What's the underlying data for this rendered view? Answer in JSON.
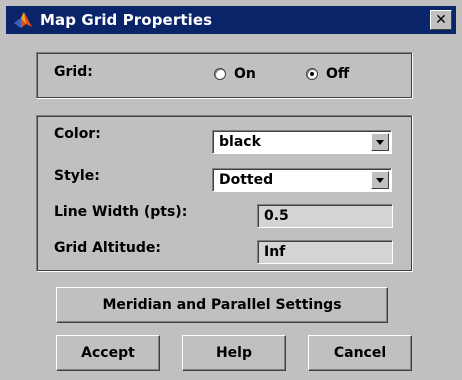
{
  "window": {
    "title": "Map Grid Properties",
    "close_label": "✕"
  },
  "grid": {
    "label": "Grid:",
    "options": [
      {
        "label": "On",
        "selected": false
      },
      {
        "label": "Off",
        "selected": true
      }
    ]
  },
  "properties": {
    "color_label": "Color:",
    "color_value": "black",
    "style_label": "Style:",
    "style_value": "Dotted",
    "line_width_label": "Line Width (pts):",
    "line_width_value": "0.5",
    "altitude_label": "Grid Altitude:",
    "altitude_value": "Inf"
  },
  "buttons": {
    "meridian": "Meridian and Parallel Settings",
    "accept": "Accept",
    "help": "Help",
    "cancel": "Cancel"
  },
  "colors": {
    "titlebar": "#0a246a",
    "face": "#c0c0c0"
  },
  "icons": {
    "app": "matlab-logo-icon",
    "close": "close-icon",
    "dropdown": "chevron-down-icon"
  }
}
